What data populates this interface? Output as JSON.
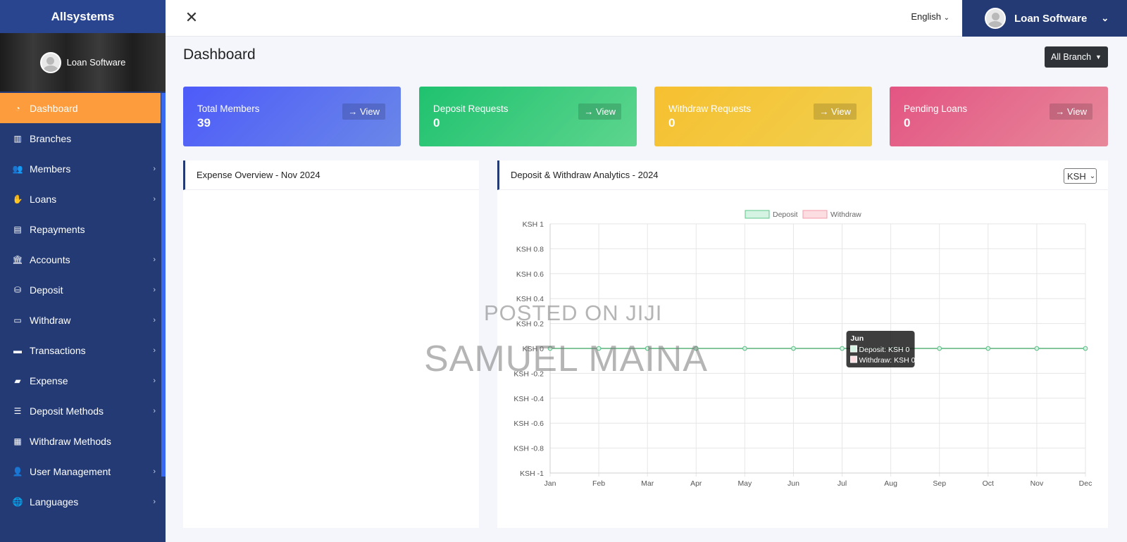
{
  "sidebar": {
    "brand": "Allsystems",
    "profile_name": "Loan Software",
    "items": [
      {
        "label": "Dashboard",
        "icon": "dashboard-icon",
        "glyph": "◔",
        "active": true,
        "submenu": false
      },
      {
        "label": "Branches",
        "icon": "building-icon",
        "glyph": "▥",
        "active": false,
        "submenu": false
      },
      {
        "label": "Members",
        "icon": "users-icon",
        "glyph": "👥",
        "active": false,
        "submenu": true
      },
      {
        "label": "Loans",
        "icon": "hand-coin-icon",
        "glyph": "✋",
        "active": false,
        "submenu": true
      },
      {
        "label": "Repayments",
        "icon": "receipt-icon",
        "glyph": "▤",
        "active": false,
        "submenu": false
      },
      {
        "label": "Accounts",
        "icon": "bank-icon",
        "glyph": "🏛",
        "active": false,
        "submenu": true
      },
      {
        "label": "Deposit",
        "icon": "coins-icon",
        "glyph": "⛁",
        "active": false,
        "submenu": true
      },
      {
        "label": "Withdraw",
        "icon": "wallet-icon",
        "glyph": "▭",
        "active": false,
        "submenu": true
      },
      {
        "label": "Transactions",
        "icon": "credit-card-icon",
        "glyph": "▬",
        "active": false,
        "submenu": true
      },
      {
        "label": "Expense",
        "icon": "money-bill-icon",
        "glyph": "▰",
        "active": false,
        "submenu": true
      },
      {
        "label": "Deposit Methods",
        "icon": "list-icon",
        "glyph": "☰",
        "active": false,
        "submenu": true
      },
      {
        "label": "Withdraw Methods",
        "icon": "clipboard-icon",
        "glyph": "▦",
        "active": false,
        "submenu": false
      },
      {
        "label": "User Management",
        "icon": "user-icon",
        "glyph": "👤",
        "active": false,
        "submenu": true
      },
      {
        "label": "Languages",
        "icon": "globe-icon",
        "glyph": "🌐",
        "active": false,
        "submenu": true
      }
    ]
  },
  "topbar": {
    "language": "English",
    "user_name": "Loan Software"
  },
  "page": {
    "title": "Dashboard",
    "branch_button": "All Branch"
  },
  "cards": [
    {
      "title": "Total Members",
      "value": "39",
      "button": "View"
    },
    {
      "title": "Deposit Requests",
      "value": "0",
      "button": "View"
    },
    {
      "title": "Withdraw Requests",
      "value": "0",
      "button": "View"
    },
    {
      "title": "Pending Loans",
      "value": "0",
      "button": "View"
    }
  ],
  "expense_panel": {
    "title": "Expense Overview - Nov 2024"
  },
  "analytics_panel": {
    "title": "Deposit & Withdraw Analytics - 2024",
    "currency_select": "KSH"
  },
  "chart_data": {
    "type": "line",
    "categories": [
      "Jan",
      "Feb",
      "Mar",
      "Apr",
      "May",
      "Jun",
      "Jul",
      "Aug",
      "Sep",
      "Oct",
      "Nov",
      "Dec"
    ],
    "series": [
      {
        "name": "Deposit",
        "values": [
          0,
          0,
          0,
          0,
          0,
          0,
          0,
          0,
          0,
          0,
          0,
          0
        ],
        "color": "#5cc48a",
        "fill": "#d4f3e2"
      },
      {
        "name": "Withdraw",
        "values": [
          0,
          0,
          0,
          0,
          0,
          0,
          0,
          0,
          0,
          0,
          0,
          0
        ],
        "color": "#f29ca8",
        "fill": "#fcdde2"
      }
    ],
    "y_ticks": [
      "KSH 1",
      "KSH 0.8",
      "KSH 0.6",
      "KSH 0.4",
      "KSH 0.2",
      "KSH 0",
      "KSH -0.2",
      "KSH -0.4",
      "KSH -0.6",
      "KSH -0.8",
      "KSH -1"
    ],
    "ylim": [
      -1,
      1
    ],
    "grid": true,
    "legend": "top-center",
    "tooltip": {
      "title": "Jun",
      "lines": [
        "Deposit: KSH 0",
        "Withdraw: KSH 0"
      ]
    }
  },
  "watermark": {
    "line1": "POSTED ON JIJI",
    "line2": "SAMUEL MAINA"
  }
}
